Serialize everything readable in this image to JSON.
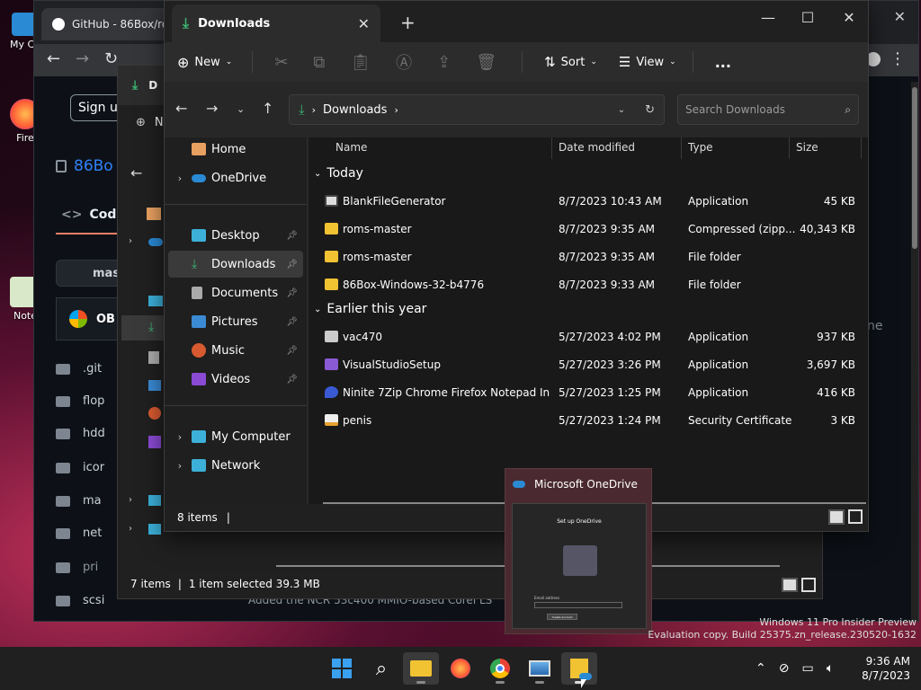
{
  "desktop": {
    "icons": [
      "My Co",
      "Fire",
      "Note"
    ]
  },
  "browser": {
    "tab_title": "GitHub - 86Box/ror",
    "signup": "Sign up",
    "repo": "86Bo",
    "code_tab": "Code",
    "branch": "mast",
    "commit_owner": "OB",
    "folders": [
      ".git",
      "flop",
      "hdd",
      "icor",
      "ma",
      "net",
      "pri",
      "scsi"
    ],
    "commit_msg": "Added the NCR 53c400 MMIO-based Corel LS",
    "right_text": "ne",
    "watermark": [
      "Windows 11 Pro Insider Preview",
      "Evaluation copy. Build 25375.zn_release.230520-1632"
    ]
  },
  "explorer2": {
    "tab_prefix": "D",
    "new_prefix": "N",
    "status_items": "7 items",
    "status_sel": "1 item selected  39.3 MB"
  },
  "explorer": {
    "tab_title": "Downloads",
    "new_label": "New",
    "sort_label": "Sort",
    "view_label": "View",
    "more": "...",
    "breadcrumb": "Downloads",
    "search_placeholder": "Search Downloads",
    "nav": {
      "home": "Home",
      "onedrive": "OneDrive",
      "desktop": "Desktop",
      "downloads": "Downloads",
      "documents": "Documents",
      "pictures": "Pictures",
      "music": "Music",
      "videos": "Videos",
      "mycomputer": "My Computer",
      "network": "Network"
    },
    "columns": {
      "name": "Name",
      "date": "Date modified",
      "type": "Type",
      "size": "Size"
    },
    "groups": {
      "today": "Today",
      "earlier": "Earlier this year"
    },
    "files_today": [
      {
        "name": "BlankFileGenerator",
        "date": "8/7/2023 10:43 AM",
        "type": "Application",
        "size": "45 KB",
        "icon": "app-icon"
      },
      {
        "name": "roms-master",
        "date": "8/7/2023 9:35 AM",
        "type": "Compressed (zipp...",
        "size": "40,343 KB",
        "icon": "zip-icon"
      },
      {
        "name": "roms-master",
        "date": "8/7/2023 9:35 AM",
        "type": "File folder",
        "size": "",
        "icon": "folder-icon"
      },
      {
        "name": "86Box-Windows-32-b4776",
        "date": "8/7/2023 9:33 AM",
        "type": "File folder",
        "size": "",
        "icon": "folder-icon"
      }
    ],
    "files_earlier": [
      {
        "name": "vac470",
        "date": "5/27/2023 4:02 PM",
        "type": "Application",
        "size": "937 KB",
        "icon": "installer-icon"
      },
      {
        "name": "VisualStudioSetup",
        "date": "5/27/2023 3:26 PM",
        "type": "Application",
        "size": "3,697 KB",
        "icon": "visual-studio-icon"
      },
      {
        "name": "Ninite 7Zip Chrome Firefox Notepad Inst...",
        "date": "5/27/2023 1:25 PM",
        "type": "Application",
        "size": "416 KB",
        "icon": "ninite-icon"
      },
      {
        "name": "penis",
        "date": "5/27/2023 1:24 PM",
        "type": "Security Certificate",
        "size": "3 KB",
        "icon": "certificate-icon"
      }
    ],
    "status": "8 items"
  },
  "onedrive_popup": {
    "title": "Microsoft OneDrive",
    "thumb_heading": "Set up OneDrive",
    "thumb_field": "Email address",
    "thumb_button": "Create account"
  },
  "taskbar": {
    "time": "9:36 AM",
    "date": "8/7/2023"
  },
  "colors": {
    "accent": "#0078d4",
    "folder": "#f1c232",
    "download_green": "#3cb371"
  }
}
